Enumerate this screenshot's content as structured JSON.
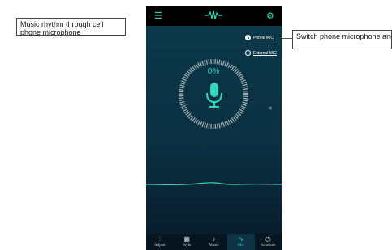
{
  "annotations": {
    "left": "Music rhythm through cell phone microphone",
    "right": "Switch phone microphone and external microphone"
  },
  "header": {
    "menu_icon": "menu-icon",
    "logo_icon": "logo-icon",
    "settings_icon": "gear-icon"
  },
  "mic_source": {
    "phone_label": "Phone MIC",
    "external_label": "External MIC",
    "selected": "Phone MIC"
  },
  "level": {
    "text": "0%"
  },
  "tabs": [
    {
      "label": "Adjust",
      "icon": "adjust-icon"
    },
    {
      "label": "Style",
      "icon": "style-icon"
    },
    {
      "label": "Music",
      "icon": "music-icon"
    },
    {
      "label": "Mic",
      "icon": "mic-icon"
    },
    {
      "label": "Schedule",
      "icon": "schedule-icon"
    }
  ],
  "active_tab": "Mic",
  "colors": {
    "accent": "#2fd8b8",
    "topbar": "#000000",
    "background": "#0a3344"
  }
}
